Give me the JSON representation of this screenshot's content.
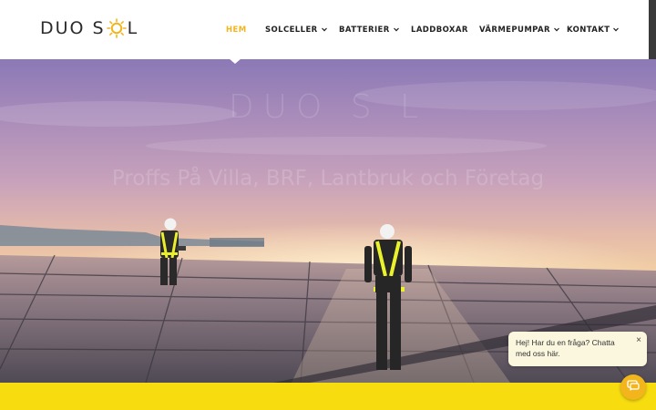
{
  "logo": {
    "part1": "DUO S",
    "part2": "L"
  },
  "nav": [
    {
      "label": "HEM",
      "dropdown": false,
      "active": true
    },
    {
      "label": "SOLCELLER",
      "dropdown": true,
      "active": false
    },
    {
      "label": "BATTERIER",
      "dropdown": true,
      "active": false
    },
    {
      "label": "LADDBOXAR",
      "dropdown": false,
      "active": false
    },
    {
      "label": "VÄRMEPUMPAR",
      "dropdown": true,
      "active": false
    },
    {
      "label": "KONTAKT",
      "dropdown": true,
      "active": false
    }
  ],
  "hero": {
    "title": "DUO S   L",
    "subtitle": "Proffs På Villa, BRF, Lantbruk och Företag"
  },
  "chat": {
    "message": "Hej! Har du en fråga? Chatta med oss här.",
    "close_symbol": "×"
  },
  "colors": {
    "accent": "#f2b51c",
    "band": "#f7dc10",
    "text": "#222222"
  },
  "icons": {
    "logo_sun": "sun-icon",
    "dropdown": "chevron-down-icon",
    "chat": "chat-icon",
    "close": "close-icon"
  }
}
